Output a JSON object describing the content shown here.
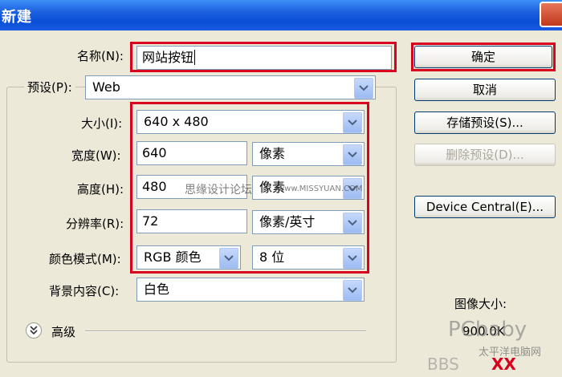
{
  "window": {
    "title": "新建"
  },
  "form": {
    "name": {
      "label": "名称(N):",
      "value": "网站按钮"
    },
    "preset": {
      "label": "预设(P):",
      "value": "Web"
    },
    "size": {
      "label": "大小(I):",
      "value": "640 x 480"
    },
    "width": {
      "label": "宽度(W):",
      "value": "640",
      "unit": "像素"
    },
    "height": {
      "label": "高度(H):",
      "value": "480",
      "unit": "像素"
    },
    "resolution": {
      "label": "分辨率(R):",
      "value": "72",
      "unit": "像素/英寸"
    },
    "color_mode": {
      "label": "颜色模式(M):",
      "value": "RGB 颜色",
      "depth": "8 位"
    },
    "background": {
      "label": "背景内容(C):",
      "value": "白色"
    },
    "advanced": {
      "label": "高级"
    }
  },
  "buttons": {
    "ok": "确定",
    "cancel": "取消",
    "save_preset": "存储预设(S)...",
    "delete_preset": "删除预设(D)...",
    "device_central": "Device Central(E)..."
  },
  "info": {
    "image_size_label": "图像大小:",
    "image_size_value": "900.0K"
  },
  "watermarks": {
    "forum": "思缘设计论坛",
    "site": "www.MISSYUAN.COM",
    "logo": "PCbaby",
    "logo_sub": "太平洋电脑网",
    "bbs": "BBS",
    "marks": "XX"
  },
  "colors": {
    "highlight_red": "#d8001c",
    "title_bar_blue": "#0a4ed6",
    "dialog_bg": "#ece9d8"
  }
}
